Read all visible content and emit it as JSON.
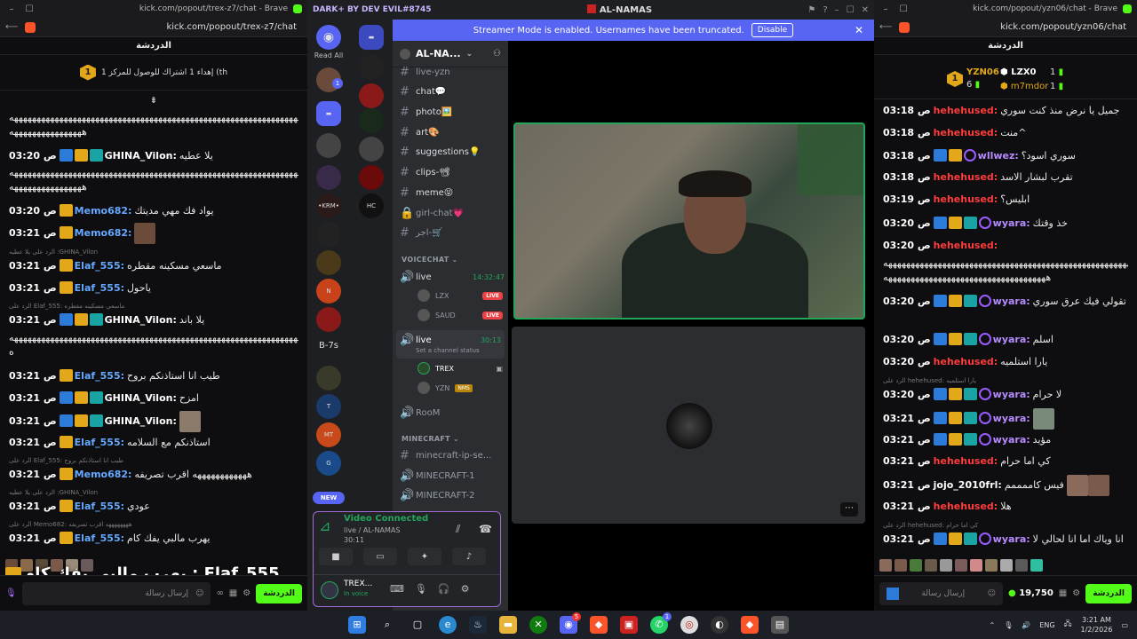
{
  "left_browser": {
    "window_title": "kick.com/popout/trex-z7/chat - Brave",
    "url": "kick.com/popout/trex-z7/chat",
    "chat_header": "الدردشة",
    "pinned_goal": "إهداء 1 اشتراك للوصول للمركز 1 (th",
    "pinned_rank": "1",
    "messages": [
      {
        "time": "",
        "user": "",
        "text": "ههههههههههههههههههههههههههههههههههههههههههههههههههههههههههههههههههههههههههههههههههه"
      },
      {
        "time": "03:20 ص",
        "user": "GHINA_Vilon:",
        "text": "يلا عطيه"
      },
      {
        "time": "",
        "user": "",
        "text": "ههههههههههههههههههههههههههههههههههههههههههههههههههههههههههههههههههههههههههههههه"
      },
      {
        "time": "03:20 ص",
        "user": "Memo682:",
        "text": "يواد فك مهي مديتك"
      },
      {
        "time": "03:21 ص",
        "user": "Memo682:",
        "text": ""
      },
      {
        "time": "03:21 ص",
        "user": "Elaf_555:",
        "text": "ماسعي مسكينه مقطره"
      },
      {
        "time": "03:21 ص",
        "user": "Elaf_555:",
        "text": "ياحول"
      },
      {
        "time": "03:21 ص",
        "user": "GHINA_Vilon:",
        "text": "يلا باند"
      },
      {
        "time": "",
        "user": "",
        "text": "ههههههههههههههههههههههههههههههههههههههههههههههههههههههههههههههههههههههههههه"
      },
      {
        "time": "03:21 ص",
        "user": "Elaf_555:",
        "text": "طيب انا استاذنكم بروح"
      },
      {
        "time": "03:21 ص",
        "user": "GHINA_Vilon:",
        "text": "امزح"
      },
      {
        "time": "03:21 ص",
        "user": "GHINA_Vilon:",
        "text": ""
      },
      {
        "time": "03:21 ص",
        "user": "Elaf_555:",
        "text": "استاذنكم مع السلامه"
      },
      {
        "time": "03:21 ص",
        "user": "Memo682:",
        "text": "ههههههههههههه اقرب تصريفه"
      },
      {
        "time": "03:21 ص",
        "user": "Elaf_555:",
        "text": "عودي"
      },
      {
        "time": "03:21 ص",
        "user": "Elaf_555:",
        "text": "يهرب مالبي يفك كام"
      }
    ],
    "replies": [
      "الرد على يلا عطيه :GHINA_Vilon",
      "الرد على Elaf_555: ماسعي مسكينه مقطره",
      "الرد على Elaf_555: طيب انا استاذنكم بروح",
      "الرد على يلا عطيه :GHINA_Vilon",
      "الرد على Memo682: ههههههههه اقرب تصريفه"
    ],
    "overlay_caption": "يهرب مالبي يفك كام : Elaf_555",
    "send_placeholder": "إرسال رسالة",
    "chat_button": "الدردشة"
  },
  "discord": {
    "title_left": "DARK+ BY DEV EVIL#8745",
    "title_center": "AL-NAMAS",
    "banner_text": "Streamer Mode is enabled. Usernames have been truncated.",
    "banner_button": "Disable",
    "read_all": "Read All",
    "server_name": "AL-NA...",
    "channels": [
      {
        "name": "live-yzn",
        "type": "text"
      },
      {
        "name": "chat💬",
        "type": "text"
      },
      {
        "name": "photo🖼️",
        "type": "text"
      },
      {
        "name": "art🎨",
        "type": "text"
      },
      {
        "name": "suggestions💡",
        "type": "text"
      },
      {
        "name": "clips-📽",
        "type": "text"
      },
      {
        "name": "meme😝",
        "type": "text"
      },
      {
        "name": "girl-chat💗",
        "type": "lock"
      },
      {
        "name": "اجر-🛒",
        "type": "lock"
      }
    ],
    "voice_category": "VOICECHAT",
    "voice_live1": {
      "name": "live",
      "timer": "14:32:47"
    },
    "voice_users1": [
      {
        "name": "LZX",
        "live": "LIVE"
      },
      {
        "name": "SAUD",
        "live": "LIVE"
      }
    ],
    "voice_live2": {
      "name": "live",
      "timer": "30:13",
      "status": "Set a channel status"
    },
    "voice_users2": [
      {
        "name": "TREX",
        "tag": ""
      },
      {
        "name": "YZN",
        "tag": "NMS"
      }
    ],
    "voice_room": "RooM",
    "mc_category": "MINECRAFT",
    "mc_channels": [
      "minecraft-ip-se...",
      "MINECRAFT-1",
      "MINECRAFT-2"
    ],
    "guild_labels": [
      "B-7s",
      "NEW"
    ],
    "guild_badge": "1",
    "video_connected": "Video Connected",
    "video_channel": "live / AL-NAMAS",
    "video_timer": "30:11",
    "self_user": "TREX...",
    "self_status": "In voice"
  },
  "right_browser": {
    "window_title": "kick.com/popout/yzn06/chat - Brave",
    "url": "kick.com/popout/yzn06/chat",
    "chat_header": "الدردشة",
    "leaderboard": [
      {
        "name": "YZN06",
        "count": "6"
      },
      {
        "name": "LZX0",
        "count": "1"
      },
      {
        "name": "m7mdor",
        "count": "1"
      }
    ],
    "messages": [
      {
        "time": "03:18 ص",
        "user": "hehehused:",
        "text": "جميل يا نرض منذ كنت سوري"
      },
      {
        "time": "03:18 ص",
        "user": "hehehused:",
        "text": "منت^"
      },
      {
        "time": "03:18 ص",
        "user": "wllwez:",
        "text": "سوري اسود؟"
      },
      {
        "time": "03:18 ص",
        "user": "hehehused:",
        "text": "تقرب لبشار الاسد"
      },
      {
        "time": "03:19 ص",
        "user": "hehehused:",
        "text": "ابليس؟"
      },
      {
        "time": "03:20 ص",
        "user": "wyara:",
        "text": "خذ وقتك"
      },
      {
        "time": "03:20 ص",
        "user": "hehehused:",
        "text": "ههههههههههههههههههههههههههههههههههههههههههههههههههههههههههههههههههههههه"
      },
      {
        "time": "03:20 ص",
        "user": "wyara:",
        "text": "ايوه تقولي فيك عرق سوري"
      },
      {
        "time": "03:20 ص",
        "user": "wyara:",
        "text": "اسلم"
      },
      {
        "time": "03:20 ص",
        "user": "hehehused:",
        "text": "يارا استلميه"
      },
      {
        "time": "03:20 ص",
        "user": "wyara:",
        "text": "لا حرام"
      },
      {
        "time": "03:21 ص",
        "user": "wyara:",
        "text": ""
      },
      {
        "time": "03:21 ص",
        "user": "wyara:",
        "text": "مؤيد"
      },
      {
        "time": "03:21 ص",
        "user": "hehehused:",
        "text": "كي اما حرام"
      },
      {
        "time": "03:21 ص",
        "user": "jojo_2010frl:",
        "text": "فيس كاممممم"
      },
      {
        "time": "03:21 ص",
        "user": "hehehused:",
        "text": "هلا"
      },
      {
        "time": "03:21 ص",
        "user": "wyara:",
        "text": "انا وياك اما انا لحالي لا"
      }
    ],
    "replies": [
      "الرد على hehehused: يارا استلميه",
      "الرد على hehehused: كي اما حرام"
    ],
    "send_placeholder": "إرسال رسالة",
    "points": "19,750",
    "chat_button": "الدردشة"
  },
  "taskbar": {
    "time": "3:21 AM",
    "date": "1/2/2026",
    "lang": "ENG",
    "badge_discord": "5",
    "badge_whatsapp": "1"
  },
  "colors": {
    "kick_green": "#53fc18",
    "discord_blurple": "#5865f2",
    "user_blue": "#64a9ff",
    "user_red": "#ff3c3c",
    "user_purple": "#b68cff",
    "user_white": "#ffffff"
  }
}
